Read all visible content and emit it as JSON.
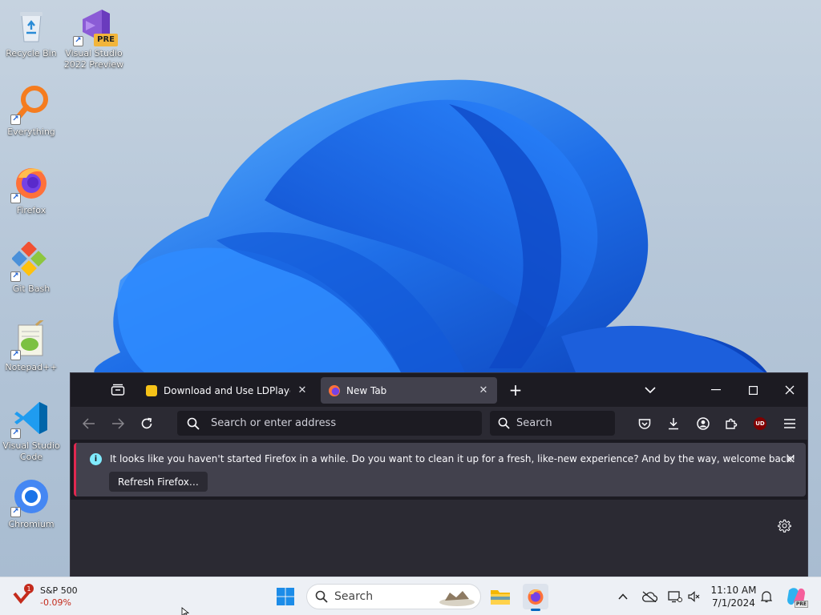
{
  "desktop": {
    "icons": [
      {
        "label": "Recycle Bin",
        "icon": "recycle-bin-icon"
      },
      {
        "label": "Visual Studio 2022 Preview",
        "icon": "visual-studio-preview-icon",
        "badge": "PRE"
      },
      {
        "label": "Everything",
        "icon": "everything-search-icon"
      },
      {
        "label": "Firefox",
        "icon": "firefox-icon"
      },
      {
        "label": "Git Bash",
        "icon": "git-bash-icon"
      },
      {
        "label": "Notepad++",
        "icon": "notepad-plus-plus-icon"
      },
      {
        "label": "Visual Studio Code",
        "icon": "vscode-icon"
      },
      {
        "label": "Chromium",
        "icon": "chromium-icon"
      }
    ]
  },
  "firefox": {
    "tabs": [
      {
        "title": "Download and Use LDPlayer on",
        "active": false,
        "icon": "ldplayer-favicon"
      },
      {
        "title": "New Tab",
        "active": true,
        "icon": "firefox-favicon"
      }
    ],
    "url_placeholder": "Search or enter address",
    "search_placeholder": "Search",
    "notification": {
      "message": "It looks like you haven't started Firefox in a while. Do you want to clean it up for a fresh, like-new experience? And by the way, welcome back!",
      "button": "Refresh Firefox…"
    },
    "ublock_badge": "UD"
  },
  "taskbar": {
    "widget": {
      "name": "S&P 500",
      "change": "-0.09%",
      "badge": "1"
    },
    "search_label": "Search",
    "time": "11:10 AM",
    "date": "7/1/2024",
    "copilot_badge": "PRE"
  },
  "colors": {
    "bloom": "#1f6fe0",
    "firefox_bg": "#1c1b22",
    "notif_accent": "#e22850",
    "stock_down": "#c42b1c"
  }
}
